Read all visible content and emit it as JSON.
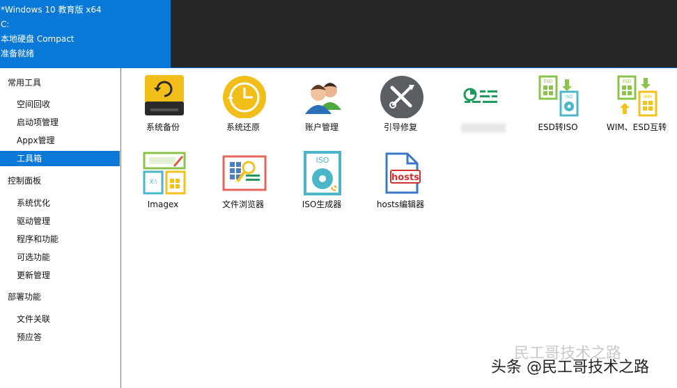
{
  "info": {
    "line1": "*Windows 10 教育版 x64",
    "line2": "C:",
    "line3": "本地硬盘 Compact",
    "line4": "准备就绪"
  },
  "sidebar": {
    "groups": [
      {
        "title": "常用工具",
        "items": [
          "空间回收",
          "启动项管理",
          "Appx管理",
          "工具箱"
        ]
      },
      {
        "title": "控制面板",
        "items": [
          "系统优化",
          "驱动管理",
          "程序和功能",
          "可选功能",
          "更新管理"
        ]
      },
      {
        "title": "部署功能",
        "items": [
          "文件关联",
          "预应答"
        ]
      }
    ],
    "selected": "工具箱"
  },
  "tools": {
    "backup": "系统备份",
    "restore": "系统还原",
    "account": "账户管理",
    "boot_repair": "引导修复",
    "esd_iso": "ESD转ISO",
    "wim_esd": "WIM、ESD互转",
    "imagex": "Imagex",
    "file_browser": "文件浏览器",
    "iso_gen": "ISO生成器",
    "hosts": "hosts编辑器"
  },
  "icon_text": {
    "hosts": "hosts",
    "iso": "ISO",
    "esd": "ESD",
    "wim": "WIM"
  },
  "watermark": {
    "main": "头条 @民工哥技术之路",
    "ghost": "民工哥技术之路"
  },
  "colors": {
    "accent": "#0a78d7",
    "dark": "#262626",
    "selected_text": "#ffffff"
  }
}
